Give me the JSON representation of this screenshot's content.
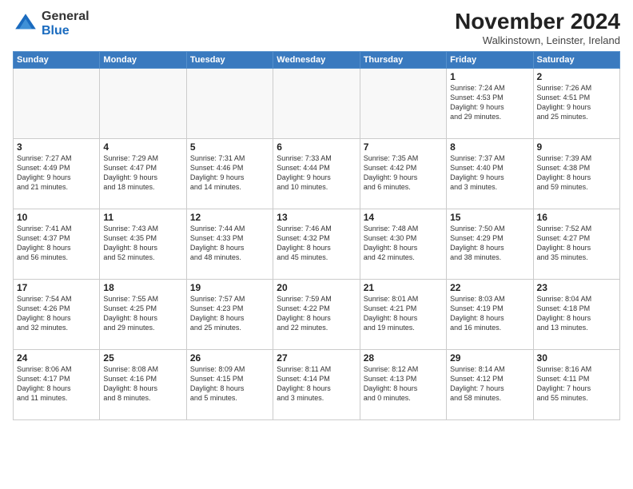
{
  "logo": {
    "general": "General",
    "blue": "Blue"
  },
  "header": {
    "month": "November 2024",
    "location": "Walkinstown, Leinster, Ireland"
  },
  "weekdays": [
    "Sunday",
    "Monday",
    "Tuesday",
    "Wednesday",
    "Thursday",
    "Friday",
    "Saturday"
  ],
  "weeks": [
    [
      {
        "day": "",
        "info": ""
      },
      {
        "day": "",
        "info": ""
      },
      {
        "day": "",
        "info": ""
      },
      {
        "day": "",
        "info": ""
      },
      {
        "day": "",
        "info": ""
      },
      {
        "day": "1",
        "info": "Sunrise: 7:24 AM\nSunset: 4:53 PM\nDaylight: 9 hours\nand 29 minutes."
      },
      {
        "day": "2",
        "info": "Sunrise: 7:26 AM\nSunset: 4:51 PM\nDaylight: 9 hours\nand 25 minutes."
      }
    ],
    [
      {
        "day": "3",
        "info": "Sunrise: 7:27 AM\nSunset: 4:49 PM\nDaylight: 9 hours\nand 21 minutes."
      },
      {
        "day": "4",
        "info": "Sunrise: 7:29 AM\nSunset: 4:47 PM\nDaylight: 9 hours\nand 18 minutes."
      },
      {
        "day": "5",
        "info": "Sunrise: 7:31 AM\nSunset: 4:46 PM\nDaylight: 9 hours\nand 14 minutes."
      },
      {
        "day": "6",
        "info": "Sunrise: 7:33 AM\nSunset: 4:44 PM\nDaylight: 9 hours\nand 10 minutes."
      },
      {
        "day": "7",
        "info": "Sunrise: 7:35 AM\nSunset: 4:42 PM\nDaylight: 9 hours\nand 6 minutes."
      },
      {
        "day": "8",
        "info": "Sunrise: 7:37 AM\nSunset: 4:40 PM\nDaylight: 9 hours\nand 3 minutes."
      },
      {
        "day": "9",
        "info": "Sunrise: 7:39 AM\nSunset: 4:38 PM\nDaylight: 8 hours\nand 59 minutes."
      }
    ],
    [
      {
        "day": "10",
        "info": "Sunrise: 7:41 AM\nSunset: 4:37 PM\nDaylight: 8 hours\nand 56 minutes."
      },
      {
        "day": "11",
        "info": "Sunrise: 7:43 AM\nSunset: 4:35 PM\nDaylight: 8 hours\nand 52 minutes."
      },
      {
        "day": "12",
        "info": "Sunrise: 7:44 AM\nSunset: 4:33 PM\nDaylight: 8 hours\nand 48 minutes."
      },
      {
        "day": "13",
        "info": "Sunrise: 7:46 AM\nSunset: 4:32 PM\nDaylight: 8 hours\nand 45 minutes."
      },
      {
        "day": "14",
        "info": "Sunrise: 7:48 AM\nSunset: 4:30 PM\nDaylight: 8 hours\nand 42 minutes."
      },
      {
        "day": "15",
        "info": "Sunrise: 7:50 AM\nSunset: 4:29 PM\nDaylight: 8 hours\nand 38 minutes."
      },
      {
        "day": "16",
        "info": "Sunrise: 7:52 AM\nSunset: 4:27 PM\nDaylight: 8 hours\nand 35 minutes."
      }
    ],
    [
      {
        "day": "17",
        "info": "Sunrise: 7:54 AM\nSunset: 4:26 PM\nDaylight: 8 hours\nand 32 minutes."
      },
      {
        "day": "18",
        "info": "Sunrise: 7:55 AM\nSunset: 4:25 PM\nDaylight: 8 hours\nand 29 minutes."
      },
      {
        "day": "19",
        "info": "Sunrise: 7:57 AM\nSunset: 4:23 PM\nDaylight: 8 hours\nand 25 minutes."
      },
      {
        "day": "20",
        "info": "Sunrise: 7:59 AM\nSunset: 4:22 PM\nDaylight: 8 hours\nand 22 minutes."
      },
      {
        "day": "21",
        "info": "Sunrise: 8:01 AM\nSunset: 4:21 PM\nDaylight: 8 hours\nand 19 minutes."
      },
      {
        "day": "22",
        "info": "Sunrise: 8:03 AM\nSunset: 4:19 PM\nDaylight: 8 hours\nand 16 minutes."
      },
      {
        "day": "23",
        "info": "Sunrise: 8:04 AM\nSunset: 4:18 PM\nDaylight: 8 hours\nand 13 minutes."
      }
    ],
    [
      {
        "day": "24",
        "info": "Sunrise: 8:06 AM\nSunset: 4:17 PM\nDaylight: 8 hours\nand 11 minutes."
      },
      {
        "day": "25",
        "info": "Sunrise: 8:08 AM\nSunset: 4:16 PM\nDaylight: 8 hours\nand 8 minutes."
      },
      {
        "day": "26",
        "info": "Sunrise: 8:09 AM\nSunset: 4:15 PM\nDaylight: 8 hours\nand 5 minutes."
      },
      {
        "day": "27",
        "info": "Sunrise: 8:11 AM\nSunset: 4:14 PM\nDaylight: 8 hours\nand 3 minutes."
      },
      {
        "day": "28",
        "info": "Sunrise: 8:12 AM\nSunset: 4:13 PM\nDaylight: 8 hours\nand 0 minutes."
      },
      {
        "day": "29",
        "info": "Sunrise: 8:14 AM\nSunset: 4:12 PM\nDaylight: 7 hours\nand 58 minutes."
      },
      {
        "day": "30",
        "info": "Sunrise: 8:16 AM\nSunset: 4:11 PM\nDaylight: 7 hours\nand 55 minutes."
      }
    ]
  ]
}
